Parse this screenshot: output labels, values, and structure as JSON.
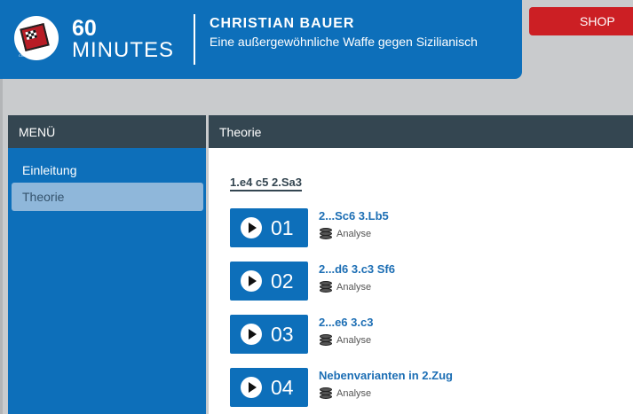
{
  "header": {
    "logo_text": "Chessbase",
    "brand_number": "60",
    "brand_word": "MINUTES",
    "author": "CHRISTIAN BAUER",
    "subtitle": "Eine außergewöhnliche Waffe gegen Sizilianisch"
  },
  "shop": {
    "label": "SHOP"
  },
  "sidebar": {
    "title": "MENÜ",
    "items": [
      {
        "label": "Einleitung",
        "active": false
      },
      {
        "label": "Theorie",
        "active": true
      }
    ]
  },
  "content": {
    "title": "Theorie",
    "section": "1.e4 c5 2.Sa3",
    "lessons": [
      {
        "number": "01",
        "title": "2...Sc6 3.Lb5",
        "type": "Analyse",
        "icon": "database-icon"
      },
      {
        "number": "02",
        "title": "2...d6 3.c3 Sf6",
        "type": "Analyse",
        "icon": "database-icon"
      },
      {
        "number": "03",
        "title": "2...e6 3.c3",
        "type": "Analyse",
        "icon": "database-icon"
      },
      {
        "number": "04",
        "title": "Nebenvarianten in 2.Zug",
        "type": "Analyse",
        "icon": "database-icon"
      }
    ]
  },
  "colors": {
    "primary": "#0d6fba",
    "dark": "#344651",
    "shop": "#cc1f24",
    "active": "#8fb7da"
  }
}
